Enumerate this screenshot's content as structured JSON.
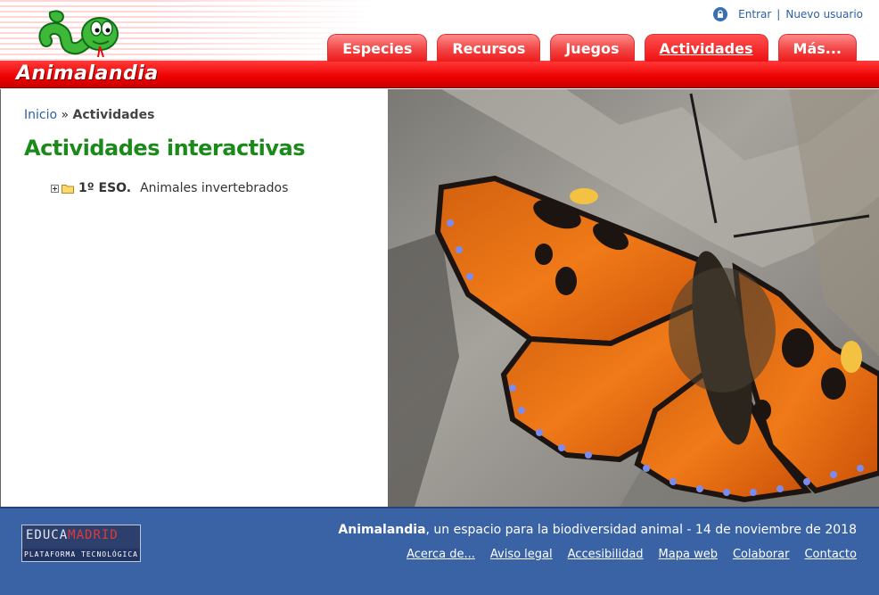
{
  "header": {
    "logo_text": "Animalandia",
    "user_links": {
      "login": "Entrar",
      "separator": "|",
      "register": "Nuevo usuario"
    },
    "tabs": [
      {
        "label": "Especies"
      },
      {
        "label": "Recursos"
      },
      {
        "label": "Juegos"
      },
      {
        "label": "Actividades",
        "active": true
      },
      {
        "label": "Más..."
      }
    ]
  },
  "breadcrumb": {
    "home": "Inicio",
    "separator": "»",
    "current": "Actividades"
  },
  "page_title": "Actividades interactivas",
  "tree": [
    {
      "level": "1º ESO.",
      "label": "Animales invertebrados"
    }
  ],
  "footer": {
    "logo_top_a": "EDUCA",
    "logo_top_b": "MADRID",
    "logo_bottom": "PLATAFORMA TECNOLÓGICA",
    "site_name": "Animalandia",
    "tagline_rest": ", un espacio para la biodiversidad animal - 14 de noviembre de 2018",
    "links": [
      "Acerca de...",
      "Aviso legal",
      "Accesibilidad",
      "Mapa web",
      "Colaborar",
      "Contacto"
    ]
  },
  "colors": {
    "brand_red": "#ee0000",
    "title_green": "#1a8a1a",
    "link_blue": "#2a5fa8",
    "footer_blue": "#3a63a6"
  }
}
